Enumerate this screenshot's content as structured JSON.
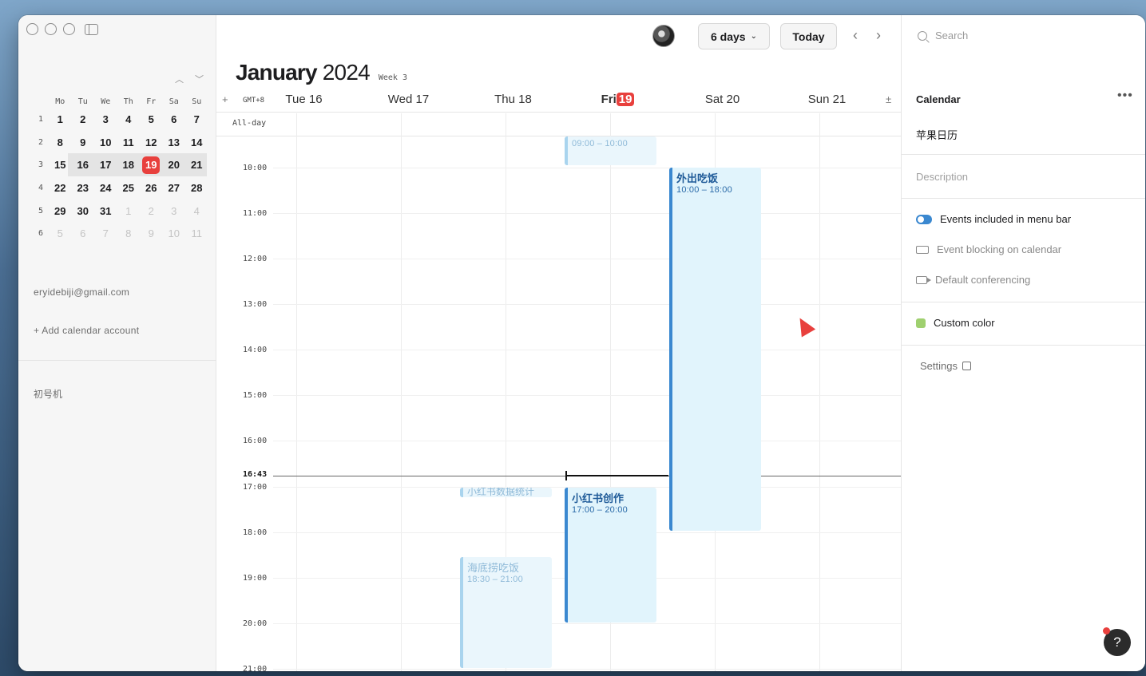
{
  "minical": {
    "nav_up": "^",
    "nav_down": "v",
    "headers": [
      "Mo",
      "Tu",
      "We",
      "Th",
      "Fr",
      "Sa",
      "Su"
    ],
    "weeks": [
      {
        "wk": "1",
        "days": [
          "1",
          "2",
          "3",
          "4",
          "5",
          "6",
          "7"
        ]
      },
      {
        "wk": "2",
        "days": [
          "8",
          "9",
          "10",
          "11",
          "12",
          "13",
          "14"
        ]
      },
      {
        "wk": "3",
        "days": [
          "15",
          "16",
          "17",
          "18",
          "19",
          "20",
          "21"
        ]
      },
      {
        "wk": "4",
        "days": [
          "22",
          "23",
          "24",
          "25",
          "26",
          "27",
          "28"
        ]
      },
      {
        "wk": "5",
        "days": [
          "29",
          "30",
          "31",
          "1",
          "2",
          "3",
          "4"
        ]
      },
      {
        "wk": "6",
        "days": [
          "5",
          "6",
          "7",
          "8",
          "9",
          "10",
          "11"
        ]
      }
    ],
    "today": "19"
  },
  "sidebar": {
    "email": "eryidebiji@gmail.com",
    "add_account": "+ Add calendar account",
    "device": "初号机"
  },
  "toolbar": {
    "days_label": "6 days",
    "today_label": "Today",
    "prev": "‹",
    "next": "›"
  },
  "header": {
    "month": "January",
    "year": "2024",
    "week": "Week 3",
    "timezone": "GMT+8",
    "add": "+",
    "expand": "±",
    "allday": "All-day",
    "days": [
      {
        "name": "Tue",
        "num": "16"
      },
      {
        "name": "Wed",
        "num": "17"
      },
      {
        "name": "Thu",
        "num": "18"
      },
      {
        "name": "Fri",
        "num": "19"
      },
      {
        "name": "Sat",
        "num": "20"
      },
      {
        "name": "Sun",
        "num": "21"
      }
    ]
  },
  "times": [
    "10:00",
    "11:00",
    "12:00",
    "13:00",
    "14:00",
    "15:00",
    "16:00",
    "17:00",
    "18:00",
    "19:00",
    "20:00",
    "21:00"
  ],
  "now": "16:43",
  "events": [
    {
      "title": "",
      "time": "09:00 – 10:00",
      "day": "Fri 19",
      "past": true
    },
    {
      "title": "外出吃饭",
      "time": "10:00 – 18:00",
      "day": "Sat 20",
      "past": false
    },
    {
      "title": "小红书数据统计",
      "time": "",
      "day": "Thu 18",
      "past": true
    },
    {
      "title": "小红书创作",
      "time": "17:00 – 20:00",
      "day": "Fri 19",
      "past": false
    },
    {
      "title": "海底捞吃饭",
      "time": "18:30 – 21:00",
      "day": "Thu 18",
      "past": true
    }
  ],
  "panel": {
    "search_placeholder": "Search",
    "title": "Calendar",
    "more": "•••",
    "calendar_name": "苹果日历",
    "description_placeholder": "Description",
    "opt_menubar": "Events included in menu bar",
    "opt_blocking": "Event blocking on calendar",
    "opt_conferencing": "Default conferencing",
    "custom_color": "Custom color",
    "settings": "Settings",
    "help": "?"
  },
  "colors": {
    "accent": "#3a88d0",
    "today": "#e8403d",
    "event_bg": "#e1f4fc",
    "custom_color": "#9fd06f"
  }
}
